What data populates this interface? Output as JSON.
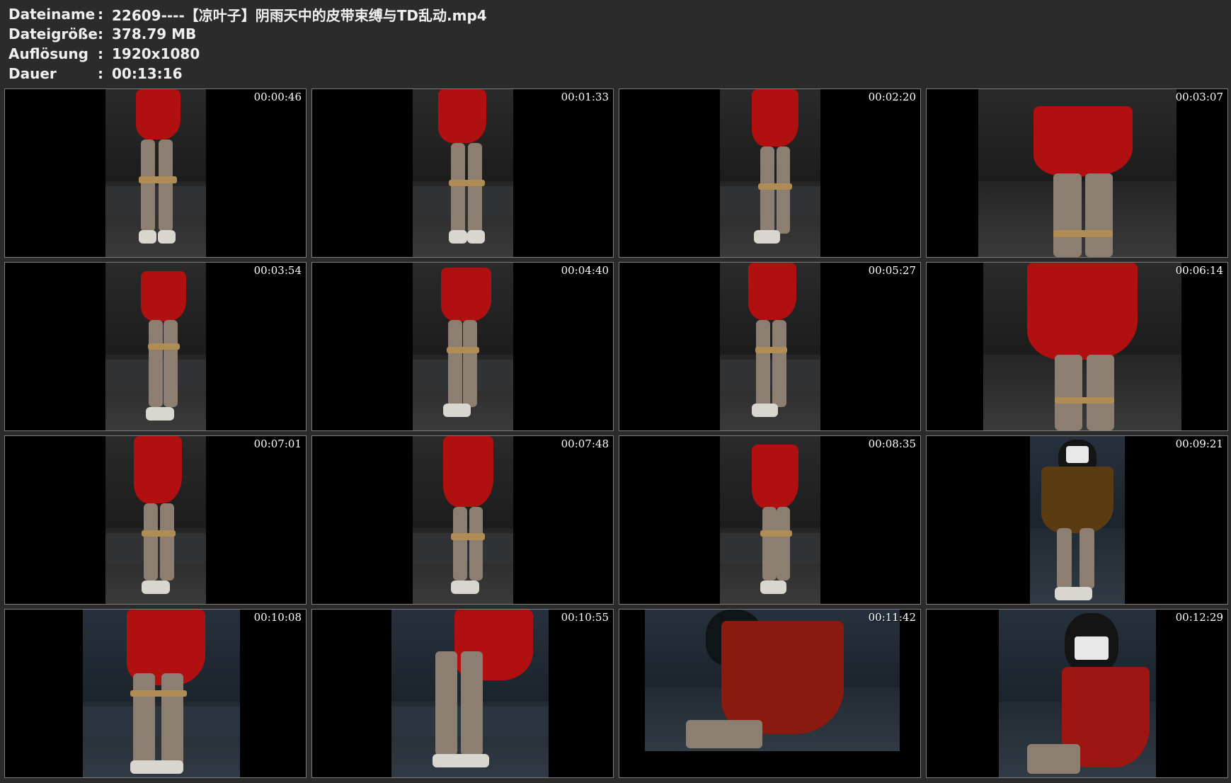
{
  "info": {
    "filename_label": "Dateiname",
    "filename_value": "22609----【凉叶子】阴雨天中的皮带束缚与TD乱动.mp4",
    "filesize_label": "Dateigröße",
    "filesize_value": "378.79 MB",
    "resolution_label": "Auflösung",
    "resolution_value": "1920x1080",
    "duration_label": "Dauer",
    "duration_value": "00:13:16",
    "separator": ":"
  },
  "thumbnails": [
    {
      "timestamp": "00:00:46"
    },
    {
      "timestamp": "00:01:33"
    },
    {
      "timestamp": "00:02:20"
    },
    {
      "timestamp": "00:03:07"
    },
    {
      "timestamp": "00:03:54"
    },
    {
      "timestamp": "00:04:40"
    },
    {
      "timestamp": "00:05:27"
    },
    {
      "timestamp": "00:06:14"
    },
    {
      "timestamp": "00:07:01"
    },
    {
      "timestamp": "00:07:48"
    },
    {
      "timestamp": "00:08:35"
    },
    {
      "timestamp": "00:09:21"
    },
    {
      "timestamp": "00:10:08"
    },
    {
      "timestamp": "00:10:55"
    },
    {
      "timestamp": "00:11:42"
    },
    {
      "timestamp": "00:12:29"
    }
  ]
}
